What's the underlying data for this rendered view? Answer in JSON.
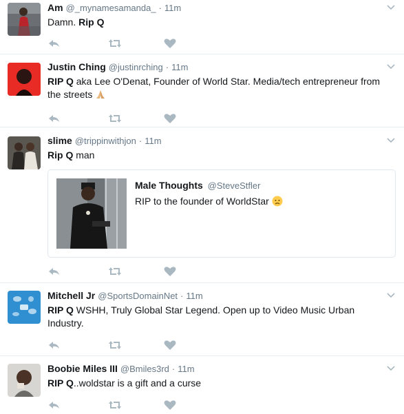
{
  "tweets": [
    {
      "fullname": "Am",
      "username": "@_mynamesamanda_",
      "dot": "·",
      "time": "11m",
      "bold": "Rip Q",
      "pre": "Damn. ",
      "rest": "",
      "avatar_icon": "avatar-woman-red-dress"
    },
    {
      "fullname": "Justin Ching",
      "username": "@justinrching",
      "dot": "·",
      "time": "11m",
      "bold": "RIP Q",
      "pre": "",
      "rest": " aka Lee O'Denat, Founder of World Star. Media/tech entrepreneur from the streets",
      "emoji": "praying-hands-emoji",
      "avatar_icon": "avatar-man-red-light"
    },
    {
      "fullname": "slime",
      "username": "@trippinwithjon",
      "dot": "·",
      "time": "11m",
      "bold": "Rip Q",
      "pre": "",
      "rest": " man",
      "avatar_icon": "avatar-two-men",
      "quote": {
        "name": "Male Thoughts",
        "username": "@SteveStfler",
        "text": "RIP to the founder of WorldStar",
        "emoji": "sad-face-emoji",
        "image_icon": "man-on-subway-photo"
      }
    },
    {
      "fullname": "Mitchell Jr",
      "username": "@SportsDomainNet",
      "dot": "·",
      "time": "11m",
      "bold": "RIP Q",
      "pre": "",
      "rest": " WSHH, Truly Global Star Legend. Open up to Video Music Urban Industry.",
      "avatar_icon": "avatar-blue-sports-logo"
    },
    {
      "fullname": "Boobie Miles III",
      "username": "@Bmiles3rd",
      "dot": "·",
      "time": "11m",
      "bold": "RIP Q",
      "pre": "",
      "rest": "..woldstar is a gift and a curse",
      "avatar_icon": "avatar-man-gray-shirt"
    }
  ],
  "colors": {
    "accent_gray": "#aab8c2",
    "meta_gray": "#657786",
    "border": "#e6ecf0",
    "text": "#14171a"
  },
  "icons": {
    "reply": "reply-icon",
    "retweet": "retweet-icon",
    "like": "heart-icon",
    "menu": "chevron-down-icon"
  }
}
